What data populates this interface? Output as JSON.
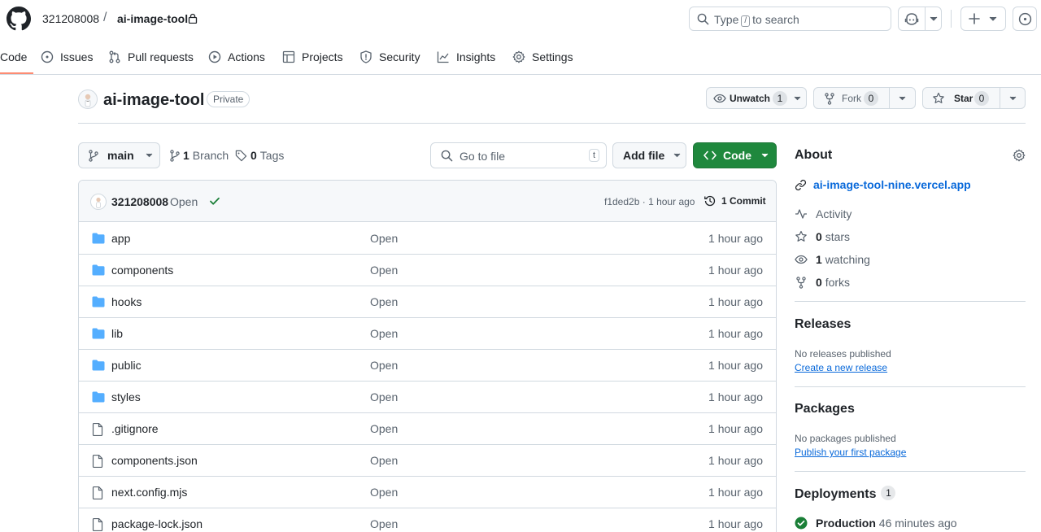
{
  "header": {
    "owner": "321208008",
    "separator": "/",
    "repo": "ai-image-tool",
    "search_prefix": "Type",
    "search_key": "/",
    "search_suffix": "to search"
  },
  "tabs": [
    {
      "label": "Code",
      "icon": "code-icon",
      "active": true
    },
    {
      "label": "Issues",
      "icon": "issue-icon"
    },
    {
      "label": "Pull requests",
      "icon": "pull-request-icon"
    },
    {
      "label": "Actions",
      "icon": "play-icon"
    },
    {
      "label": "Projects",
      "icon": "table-icon"
    },
    {
      "label": "Security",
      "icon": "shield-icon"
    },
    {
      "label": "Insights",
      "icon": "graph-icon"
    },
    {
      "label": "Settings",
      "icon": "gear-icon"
    }
  ],
  "repo_header": {
    "title": "ai-image-tool",
    "visibility": "Private",
    "unwatch_label": "Unwatch",
    "watch_count": "1",
    "fork_label": "Fork",
    "fork_count": "0",
    "star_label": "Star",
    "star_count": "0"
  },
  "toolbar": {
    "branch": "main",
    "branch_count": "1",
    "branch_label": "Branch",
    "tag_count": "0",
    "tag_label": "Tags",
    "goto_placeholder": "Go to file",
    "goto_key": "t",
    "add_file_label": "Add file",
    "code_label": "Code"
  },
  "commit": {
    "author": "321208008",
    "message": "Open",
    "sha": "f1ded2b",
    "time": "1 hour ago",
    "meta_sep": "·",
    "history_label": "1 Commit"
  },
  "files": [
    {
      "name": "app",
      "type": "folder",
      "message": "Open",
      "time": "1 hour ago"
    },
    {
      "name": "components",
      "type": "folder",
      "message": "Open",
      "time": "1 hour ago"
    },
    {
      "name": "hooks",
      "type": "folder",
      "message": "Open",
      "time": "1 hour ago"
    },
    {
      "name": "lib",
      "type": "folder",
      "message": "Open",
      "time": "1 hour ago"
    },
    {
      "name": "public",
      "type": "folder",
      "message": "Open",
      "time": "1 hour ago"
    },
    {
      "name": "styles",
      "type": "folder",
      "message": "Open",
      "time": "1 hour ago"
    },
    {
      "name": ".gitignore",
      "type": "file",
      "message": "Open",
      "time": "1 hour ago"
    },
    {
      "name": "components.json",
      "type": "file",
      "message": "Open",
      "time": "1 hour ago"
    },
    {
      "name": "next.config.mjs",
      "type": "file",
      "message": "Open",
      "time": "1 hour ago"
    },
    {
      "name": "package-lock.json",
      "type": "file",
      "message": "Open",
      "time": "1 hour ago"
    }
  ],
  "sidebar": {
    "about_title": "About",
    "website": "ai-image-tool-nine.vercel.app",
    "activity_label": "Activity",
    "stars_count": "0",
    "stars_label": "stars",
    "watching_count": "1",
    "watching_label": "watching",
    "forks_count": "0",
    "forks_label": "forks",
    "releases_title": "Releases",
    "releases_empty": "No releases published",
    "releases_link": "Create a new release",
    "packages_title": "Packages",
    "packages_empty": "No packages published",
    "packages_link": "Publish your first package",
    "deployments_title": "Deployments",
    "deployments_count": "1",
    "deploy_env": "Production",
    "deploy_time": "46 minutes ago"
  },
  "colors": {
    "accent_green": "#1f883d",
    "link_blue": "#0969da",
    "folder_blue": "#54aeff",
    "tab_underline": "#fd8c73"
  }
}
